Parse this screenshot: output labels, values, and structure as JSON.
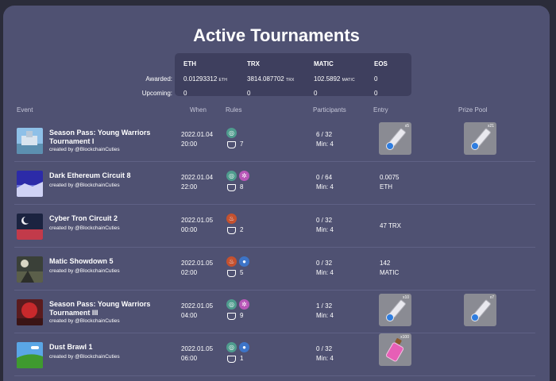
{
  "page": {
    "title": "Active Tournaments"
  },
  "summary": {
    "columns": [
      "ETH",
      "TRX",
      "MATIC",
      "EOS"
    ],
    "awarded_label": "Awarded:",
    "upcoming_label": "Upcoming:",
    "awarded": [
      {
        "value": "0.01293312",
        "unit": "ETH"
      },
      {
        "value": "3814.087702",
        "unit": "TRX"
      },
      {
        "value": "102.5892",
        "unit": "MATIC"
      },
      {
        "value": "0",
        "unit": ""
      }
    ],
    "upcoming": [
      "0",
      "0",
      "0",
      "0"
    ]
  },
  "table": {
    "headers": {
      "event": "Event",
      "when": "When",
      "rules": "Rules",
      "participants": "Participants",
      "entry": "Entry",
      "prize_pool": "Prize Pool"
    },
    "rows": [
      {
        "name_line1": "Season Pass: Young Warriors",
        "name_line2": "Tournament I",
        "creator": "created by @BlockchainCuties",
        "date": "2022.01.04",
        "time": "20:00",
        "rule_icons": [
          "air"
        ],
        "pot_count": "7",
        "participants": "6 / 32",
        "min": "Min: 4",
        "entry_item_qty": "x5",
        "prize_item_qty": "x21"
      },
      {
        "name_line1": "Dark Ethereum Circuit 8",
        "name_line2": "",
        "creator": "created by @BlockchainCuties",
        "date": "2022.01.04",
        "time": "22:00",
        "rule_icons": [
          "air",
          "nature"
        ],
        "pot_count": "8",
        "participants": "0 / 64",
        "min": "Min: 4",
        "entry_line1": "0.0075",
        "entry_line2": "ETH"
      },
      {
        "name_line1": "Cyber Tron Circuit 2",
        "name_line2": "",
        "creator": "created by @BlockchainCuties",
        "date": "2022.01.05",
        "time": "00:00",
        "rule_icons": [
          "fire"
        ],
        "pot_count": "2",
        "participants": "0 / 32",
        "min": "Min: 4",
        "entry_line1": "47 TRX",
        "entry_line2": ""
      },
      {
        "name_line1": "Matic Showdown 5",
        "name_line2": "",
        "creator": "created by @BlockchainCuties",
        "date": "2022.01.05",
        "time": "02:00",
        "rule_icons": [
          "fire",
          "water"
        ],
        "pot_count": "5",
        "participants": "0 / 32",
        "min": "Min: 4",
        "entry_line1": "142",
        "entry_line2": "MATIC"
      },
      {
        "name_line1": "Season Pass: Young Warriors",
        "name_line2": "Tournament III",
        "creator": "created by @BlockchainCuties",
        "date": "2022.01.05",
        "time": "04:00",
        "rule_icons": [
          "air",
          "nature"
        ],
        "pot_count": "9",
        "participants": "1 / 32",
        "min": "Min: 4",
        "entry_item_qty": "x10",
        "prize_item_qty": "x7"
      },
      {
        "name_line1": "Dust Brawl 1",
        "name_line2": "",
        "creator": "created by @BlockchainCuties",
        "date": "2022.01.05",
        "time": "06:00",
        "rule_icons": [
          "air",
          "water"
        ],
        "pot_count": "1",
        "participants": "0 / 32",
        "min": "Min: 4",
        "entry_item_qty": "x100"
      }
    ]
  },
  "colors": {
    "background": "#2b2c3a",
    "panel": "#4f5172",
    "summary_box": "#3e3f5e",
    "air": "#4f9c8e",
    "nature": "#b857b8",
    "fire": "#c4512f",
    "water": "#3d74c7",
    "item_bg": "#8a8b93"
  }
}
